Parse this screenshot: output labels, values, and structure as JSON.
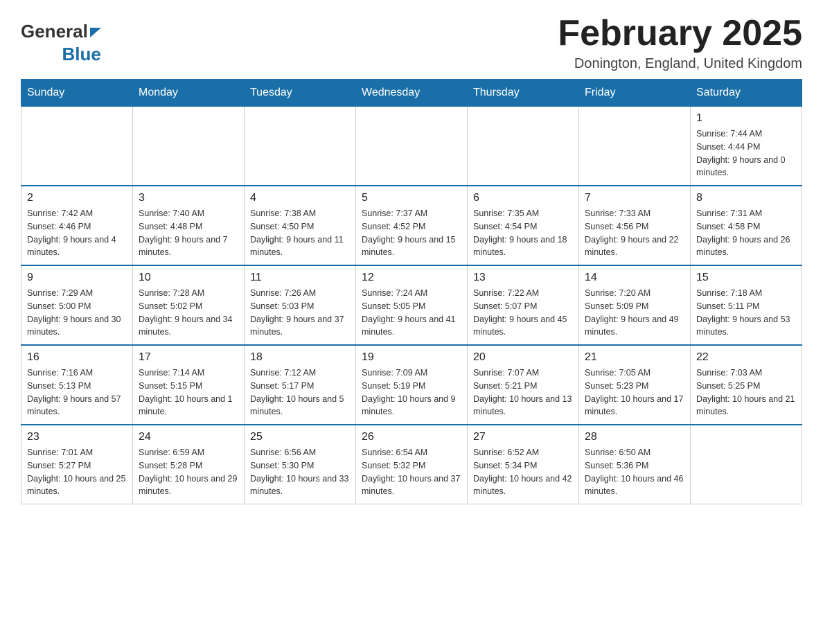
{
  "header": {
    "logo": {
      "general": "General",
      "blue": "Blue"
    },
    "title": "February 2025",
    "location": "Donington, England, United Kingdom"
  },
  "weekdays": [
    "Sunday",
    "Monday",
    "Tuesday",
    "Wednesday",
    "Thursday",
    "Friday",
    "Saturday"
  ],
  "weeks": [
    [
      {
        "day": "",
        "info": ""
      },
      {
        "day": "",
        "info": ""
      },
      {
        "day": "",
        "info": ""
      },
      {
        "day": "",
        "info": ""
      },
      {
        "day": "",
        "info": ""
      },
      {
        "day": "",
        "info": ""
      },
      {
        "day": "1",
        "info": "Sunrise: 7:44 AM\nSunset: 4:44 PM\nDaylight: 9 hours and 0 minutes."
      }
    ],
    [
      {
        "day": "2",
        "info": "Sunrise: 7:42 AM\nSunset: 4:46 PM\nDaylight: 9 hours and 4 minutes."
      },
      {
        "day": "3",
        "info": "Sunrise: 7:40 AM\nSunset: 4:48 PM\nDaylight: 9 hours and 7 minutes."
      },
      {
        "day": "4",
        "info": "Sunrise: 7:38 AM\nSunset: 4:50 PM\nDaylight: 9 hours and 11 minutes."
      },
      {
        "day": "5",
        "info": "Sunrise: 7:37 AM\nSunset: 4:52 PM\nDaylight: 9 hours and 15 minutes."
      },
      {
        "day": "6",
        "info": "Sunrise: 7:35 AM\nSunset: 4:54 PM\nDaylight: 9 hours and 18 minutes."
      },
      {
        "day": "7",
        "info": "Sunrise: 7:33 AM\nSunset: 4:56 PM\nDaylight: 9 hours and 22 minutes."
      },
      {
        "day": "8",
        "info": "Sunrise: 7:31 AM\nSunset: 4:58 PM\nDaylight: 9 hours and 26 minutes."
      }
    ],
    [
      {
        "day": "9",
        "info": "Sunrise: 7:29 AM\nSunset: 5:00 PM\nDaylight: 9 hours and 30 minutes."
      },
      {
        "day": "10",
        "info": "Sunrise: 7:28 AM\nSunset: 5:02 PM\nDaylight: 9 hours and 34 minutes."
      },
      {
        "day": "11",
        "info": "Sunrise: 7:26 AM\nSunset: 5:03 PM\nDaylight: 9 hours and 37 minutes."
      },
      {
        "day": "12",
        "info": "Sunrise: 7:24 AM\nSunset: 5:05 PM\nDaylight: 9 hours and 41 minutes."
      },
      {
        "day": "13",
        "info": "Sunrise: 7:22 AM\nSunset: 5:07 PM\nDaylight: 9 hours and 45 minutes."
      },
      {
        "day": "14",
        "info": "Sunrise: 7:20 AM\nSunset: 5:09 PM\nDaylight: 9 hours and 49 minutes."
      },
      {
        "day": "15",
        "info": "Sunrise: 7:18 AM\nSunset: 5:11 PM\nDaylight: 9 hours and 53 minutes."
      }
    ],
    [
      {
        "day": "16",
        "info": "Sunrise: 7:16 AM\nSunset: 5:13 PM\nDaylight: 9 hours and 57 minutes."
      },
      {
        "day": "17",
        "info": "Sunrise: 7:14 AM\nSunset: 5:15 PM\nDaylight: 10 hours and 1 minute."
      },
      {
        "day": "18",
        "info": "Sunrise: 7:12 AM\nSunset: 5:17 PM\nDaylight: 10 hours and 5 minutes."
      },
      {
        "day": "19",
        "info": "Sunrise: 7:09 AM\nSunset: 5:19 PM\nDaylight: 10 hours and 9 minutes."
      },
      {
        "day": "20",
        "info": "Sunrise: 7:07 AM\nSunset: 5:21 PM\nDaylight: 10 hours and 13 minutes."
      },
      {
        "day": "21",
        "info": "Sunrise: 7:05 AM\nSunset: 5:23 PM\nDaylight: 10 hours and 17 minutes."
      },
      {
        "day": "22",
        "info": "Sunrise: 7:03 AM\nSunset: 5:25 PM\nDaylight: 10 hours and 21 minutes."
      }
    ],
    [
      {
        "day": "23",
        "info": "Sunrise: 7:01 AM\nSunset: 5:27 PM\nDaylight: 10 hours and 25 minutes."
      },
      {
        "day": "24",
        "info": "Sunrise: 6:59 AM\nSunset: 5:28 PM\nDaylight: 10 hours and 29 minutes."
      },
      {
        "day": "25",
        "info": "Sunrise: 6:56 AM\nSunset: 5:30 PM\nDaylight: 10 hours and 33 minutes."
      },
      {
        "day": "26",
        "info": "Sunrise: 6:54 AM\nSunset: 5:32 PM\nDaylight: 10 hours and 37 minutes."
      },
      {
        "day": "27",
        "info": "Sunrise: 6:52 AM\nSunset: 5:34 PM\nDaylight: 10 hours and 42 minutes."
      },
      {
        "day": "28",
        "info": "Sunrise: 6:50 AM\nSunset: 5:36 PM\nDaylight: 10 hours and 46 minutes."
      },
      {
        "day": "",
        "info": ""
      }
    ]
  ]
}
